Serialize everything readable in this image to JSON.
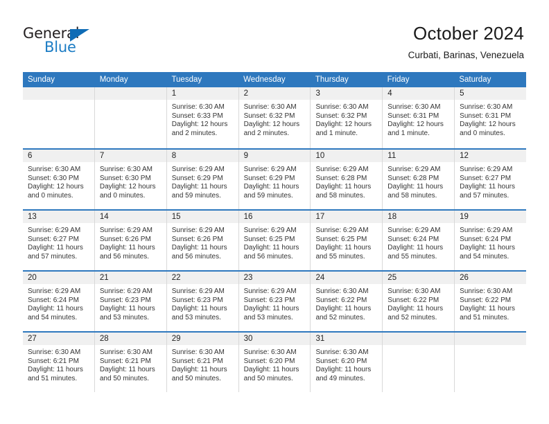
{
  "brand": {
    "name_top": "General",
    "name_bottom": "Blue",
    "triangle_color": "#0f6cb6",
    "text_color": "#231f20",
    "accent_color": "#1b7cc4"
  },
  "header": {
    "title": "October 2024",
    "subtitle": "Curbati, Barinas, Venezuela"
  },
  "theme": {
    "header_bg": "#2e78be",
    "daynum_bg": "#f0f0f0",
    "cell_border": "#d8d8d8"
  },
  "weekdays": [
    "Sunday",
    "Monday",
    "Tuesday",
    "Wednesday",
    "Thursday",
    "Friday",
    "Saturday"
  ],
  "labels": {
    "sunrise": "Sunrise:",
    "sunset": "Sunset:",
    "daylight": "Daylight:"
  },
  "weeks": [
    [
      {
        "day": "",
        "sunrise": "",
        "sunset": "",
        "daylight_1": "",
        "daylight_2": ""
      },
      {
        "day": "",
        "sunrise": "",
        "sunset": "",
        "daylight_1": "",
        "daylight_2": ""
      },
      {
        "day": "1",
        "sunrise": "Sunrise: 6:30 AM",
        "sunset": "Sunset: 6:33 PM",
        "daylight_1": "Daylight: 12 hours",
        "daylight_2": "and 2 minutes."
      },
      {
        "day": "2",
        "sunrise": "Sunrise: 6:30 AM",
        "sunset": "Sunset: 6:32 PM",
        "daylight_1": "Daylight: 12 hours",
        "daylight_2": "and 2 minutes."
      },
      {
        "day": "3",
        "sunrise": "Sunrise: 6:30 AM",
        "sunset": "Sunset: 6:32 PM",
        "daylight_1": "Daylight: 12 hours",
        "daylight_2": "and 1 minute."
      },
      {
        "day": "4",
        "sunrise": "Sunrise: 6:30 AM",
        "sunset": "Sunset: 6:31 PM",
        "daylight_1": "Daylight: 12 hours",
        "daylight_2": "and 1 minute."
      },
      {
        "day": "5",
        "sunrise": "Sunrise: 6:30 AM",
        "sunset": "Sunset: 6:31 PM",
        "daylight_1": "Daylight: 12 hours",
        "daylight_2": "and 0 minutes."
      }
    ],
    [
      {
        "day": "6",
        "sunrise": "Sunrise: 6:30 AM",
        "sunset": "Sunset: 6:30 PM",
        "daylight_1": "Daylight: 12 hours",
        "daylight_2": "and 0 minutes."
      },
      {
        "day": "7",
        "sunrise": "Sunrise: 6:30 AM",
        "sunset": "Sunset: 6:30 PM",
        "daylight_1": "Daylight: 12 hours",
        "daylight_2": "and 0 minutes."
      },
      {
        "day": "8",
        "sunrise": "Sunrise: 6:29 AM",
        "sunset": "Sunset: 6:29 PM",
        "daylight_1": "Daylight: 11 hours",
        "daylight_2": "and 59 minutes."
      },
      {
        "day": "9",
        "sunrise": "Sunrise: 6:29 AM",
        "sunset": "Sunset: 6:29 PM",
        "daylight_1": "Daylight: 11 hours",
        "daylight_2": "and 59 minutes."
      },
      {
        "day": "10",
        "sunrise": "Sunrise: 6:29 AM",
        "sunset": "Sunset: 6:28 PM",
        "daylight_1": "Daylight: 11 hours",
        "daylight_2": "and 58 minutes."
      },
      {
        "day": "11",
        "sunrise": "Sunrise: 6:29 AM",
        "sunset": "Sunset: 6:28 PM",
        "daylight_1": "Daylight: 11 hours",
        "daylight_2": "and 58 minutes."
      },
      {
        "day": "12",
        "sunrise": "Sunrise: 6:29 AM",
        "sunset": "Sunset: 6:27 PM",
        "daylight_1": "Daylight: 11 hours",
        "daylight_2": "and 57 minutes."
      }
    ],
    [
      {
        "day": "13",
        "sunrise": "Sunrise: 6:29 AM",
        "sunset": "Sunset: 6:27 PM",
        "daylight_1": "Daylight: 11 hours",
        "daylight_2": "and 57 minutes."
      },
      {
        "day": "14",
        "sunrise": "Sunrise: 6:29 AM",
        "sunset": "Sunset: 6:26 PM",
        "daylight_1": "Daylight: 11 hours",
        "daylight_2": "and 56 minutes."
      },
      {
        "day": "15",
        "sunrise": "Sunrise: 6:29 AM",
        "sunset": "Sunset: 6:26 PM",
        "daylight_1": "Daylight: 11 hours",
        "daylight_2": "and 56 minutes."
      },
      {
        "day": "16",
        "sunrise": "Sunrise: 6:29 AM",
        "sunset": "Sunset: 6:25 PM",
        "daylight_1": "Daylight: 11 hours",
        "daylight_2": "and 56 minutes."
      },
      {
        "day": "17",
        "sunrise": "Sunrise: 6:29 AM",
        "sunset": "Sunset: 6:25 PM",
        "daylight_1": "Daylight: 11 hours",
        "daylight_2": "and 55 minutes."
      },
      {
        "day": "18",
        "sunrise": "Sunrise: 6:29 AM",
        "sunset": "Sunset: 6:24 PM",
        "daylight_1": "Daylight: 11 hours",
        "daylight_2": "and 55 minutes."
      },
      {
        "day": "19",
        "sunrise": "Sunrise: 6:29 AM",
        "sunset": "Sunset: 6:24 PM",
        "daylight_1": "Daylight: 11 hours",
        "daylight_2": "and 54 minutes."
      }
    ],
    [
      {
        "day": "20",
        "sunrise": "Sunrise: 6:29 AM",
        "sunset": "Sunset: 6:24 PM",
        "daylight_1": "Daylight: 11 hours",
        "daylight_2": "and 54 minutes."
      },
      {
        "day": "21",
        "sunrise": "Sunrise: 6:29 AM",
        "sunset": "Sunset: 6:23 PM",
        "daylight_1": "Daylight: 11 hours",
        "daylight_2": "and 53 minutes."
      },
      {
        "day": "22",
        "sunrise": "Sunrise: 6:29 AM",
        "sunset": "Sunset: 6:23 PM",
        "daylight_1": "Daylight: 11 hours",
        "daylight_2": "and 53 minutes."
      },
      {
        "day": "23",
        "sunrise": "Sunrise: 6:29 AM",
        "sunset": "Sunset: 6:23 PM",
        "daylight_1": "Daylight: 11 hours",
        "daylight_2": "and 53 minutes."
      },
      {
        "day": "24",
        "sunrise": "Sunrise: 6:30 AM",
        "sunset": "Sunset: 6:22 PM",
        "daylight_1": "Daylight: 11 hours",
        "daylight_2": "and 52 minutes."
      },
      {
        "day": "25",
        "sunrise": "Sunrise: 6:30 AM",
        "sunset": "Sunset: 6:22 PM",
        "daylight_1": "Daylight: 11 hours",
        "daylight_2": "and 52 minutes."
      },
      {
        "day": "26",
        "sunrise": "Sunrise: 6:30 AM",
        "sunset": "Sunset: 6:22 PM",
        "daylight_1": "Daylight: 11 hours",
        "daylight_2": "and 51 minutes."
      }
    ],
    [
      {
        "day": "27",
        "sunrise": "Sunrise: 6:30 AM",
        "sunset": "Sunset: 6:21 PM",
        "daylight_1": "Daylight: 11 hours",
        "daylight_2": "and 51 minutes."
      },
      {
        "day": "28",
        "sunrise": "Sunrise: 6:30 AM",
        "sunset": "Sunset: 6:21 PM",
        "daylight_1": "Daylight: 11 hours",
        "daylight_2": "and 50 minutes."
      },
      {
        "day": "29",
        "sunrise": "Sunrise: 6:30 AM",
        "sunset": "Sunset: 6:21 PM",
        "daylight_1": "Daylight: 11 hours",
        "daylight_2": "and 50 minutes."
      },
      {
        "day": "30",
        "sunrise": "Sunrise: 6:30 AM",
        "sunset": "Sunset: 6:20 PM",
        "daylight_1": "Daylight: 11 hours",
        "daylight_2": "and 50 minutes."
      },
      {
        "day": "31",
        "sunrise": "Sunrise: 6:30 AM",
        "sunset": "Sunset: 6:20 PM",
        "daylight_1": "Daylight: 11 hours",
        "daylight_2": "and 49 minutes."
      },
      {
        "day": "",
        "sunrise": "",
        "sunset": "",
        "daylight_1": "",
        "daylight_2": ""
      },
      {
        "day": "",
        "sunrise": "",
        "sunset": "",
        "daylight_1": "",
        "daylight_2": ""
      }
    ]
  ]
}
